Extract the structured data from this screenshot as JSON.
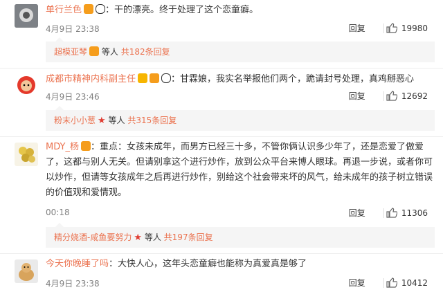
{
  "comments": [
    {
      "username": "单行兰色",
      "text": "：干的漂亮。终于处理了这个恋童癖。",
      "time": "4月9日 23:38",
      "reply_label": "回复",
      "likes": "19980",
      "sub": {
        "name": "超模亚琴",
        "mid": "等人",
        "total": "共182条回复"
      }
    },
    {
      "username": "成都市精神内科副主任",
      "text": "：甘霖娘，我实名举报他们两个，跪请封号处理，真鸡掰恶心",
      "time": "4月9日 23:46",
      "reply_label": "回复",
      "likes": "12692",
      "sub": {
        "name": "粉末小小葱",
        "mid": "等人",
        "total": "共315条回复"
      }
    },
    {
      "username": "MDY_杨",
      "text": "：重点：女孩未成年，而男方已经三十多，不管你俩认识多少年了，还是恋爱了做爱了，这都与别人无关。但请别拿这个进行炒作，放到公众平台来博人眼球。再退一步说，或者你可以炒作，但请等女孩成年之后再进行炒作，别给这个社会带来坏的风气，给未成年的孩子树立错误的价值观和爱情观。",
      "time": "00:18",
      "reply_label": "回复",
      "likes": "11306",
      "sub": {
        "name": "精分娆酒-咸鱼要努力",
        "mid": "等人",
        "total": "共197条回复"
      }
    },
    {
      "username": "今天你晚睡了吗",
      "text": "：大快人心，这年头恋童癖也能称为真爱真是够了",
      "time": "4月9日 23:38",
      "reply_label": "回复",
      "likes": "10412"
    }
  ],
  "colors": {
    "username": "#eb7350",
    "meta": "#808080",
    "subbox_bg": "#f5f5f5"
  }
}
